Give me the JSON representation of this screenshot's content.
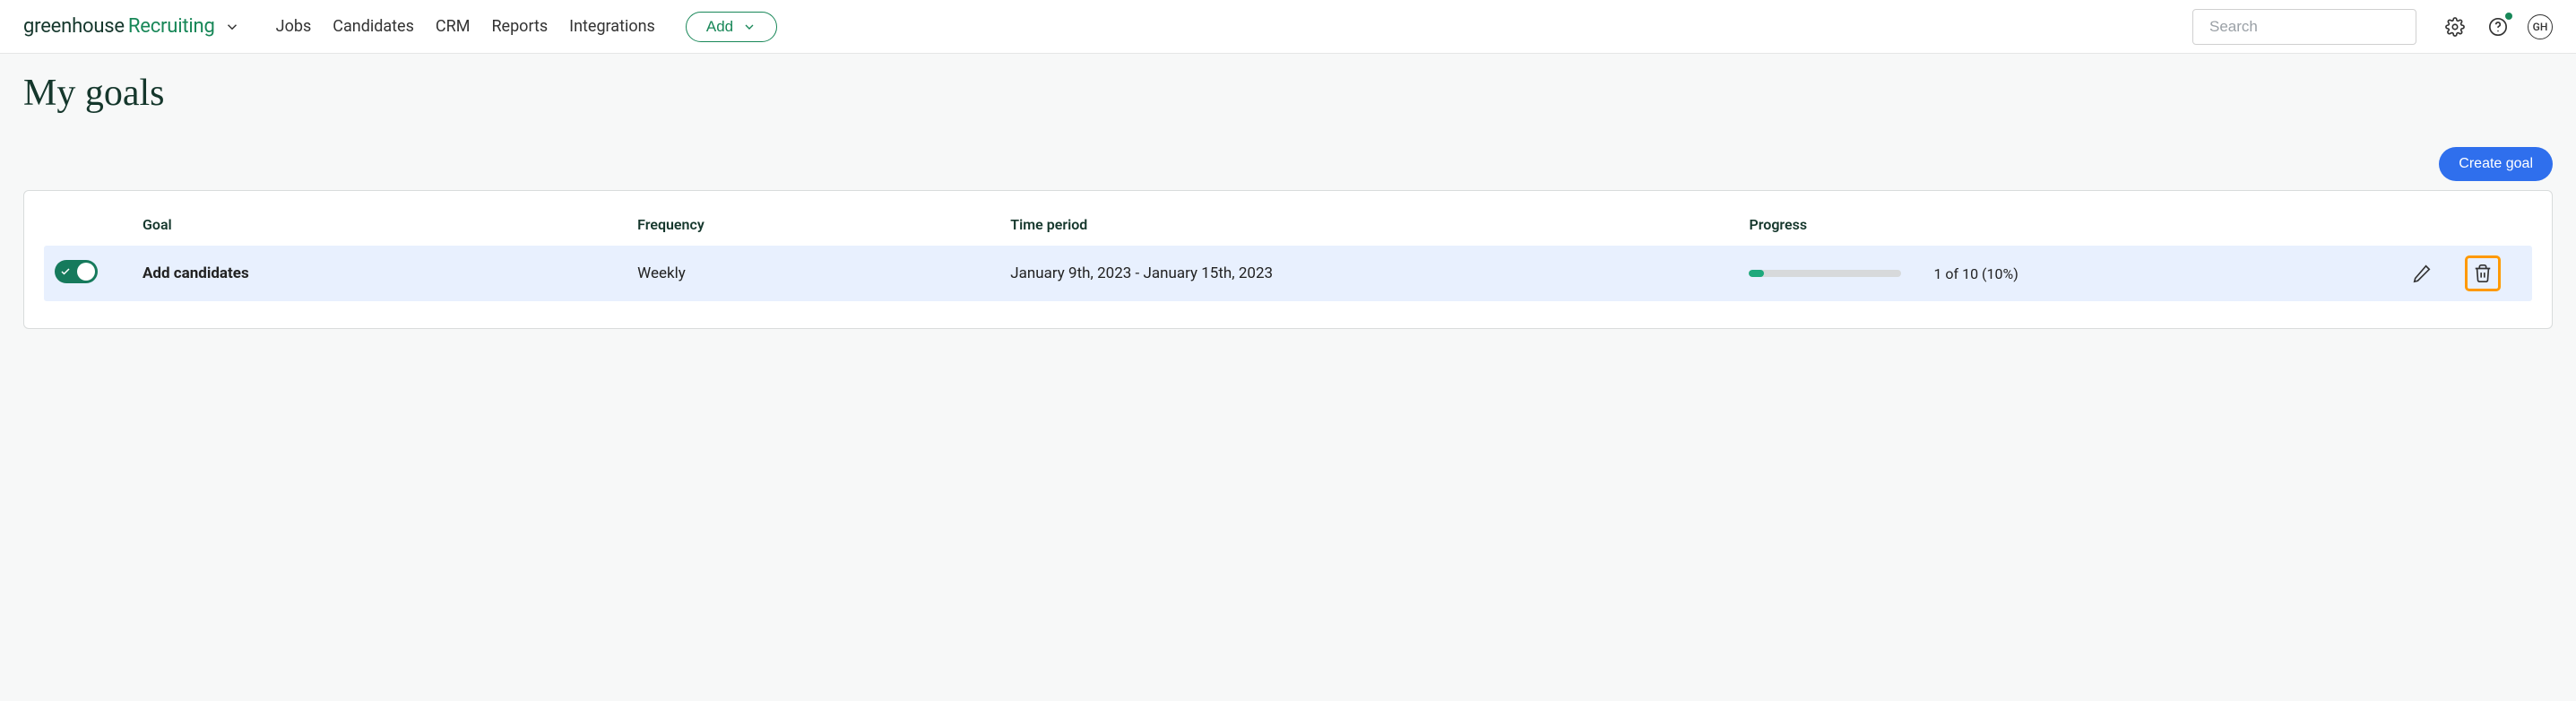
{
  "brand": {
    "part1": "greenhouse",
    "part2": "Recruiting"
  },
  "nav": {
    "items": [
      "Jobs",
      "Candidates",
      "CRM",
      "Reports",
      "Integrations"
    ],
    "add_label": "Add"
  },
  "search": {
    "placeholder": "Search"
  },
  "avatar": {
    "initials": "GH"
  },
  "page": {
    "title": "My goals",
    "create_label": "Create goal"
  },
  "table": {
    "headers": {
      "goal": "Goal",
      "frequency": "Frequency",
      "time_period": "Time period",
      "progress": "Progress"
    },
    "rows": [
      {
        "active": true,
        "name": "Add candidates",
        "frequency": "Weekly",
        "time_period": "January 9th, 2023 - January 15th, 2023",
        "progress_pct": 10,
        "progress_text": "1 of 10 (10%)"
      }
    ]
  }
}
